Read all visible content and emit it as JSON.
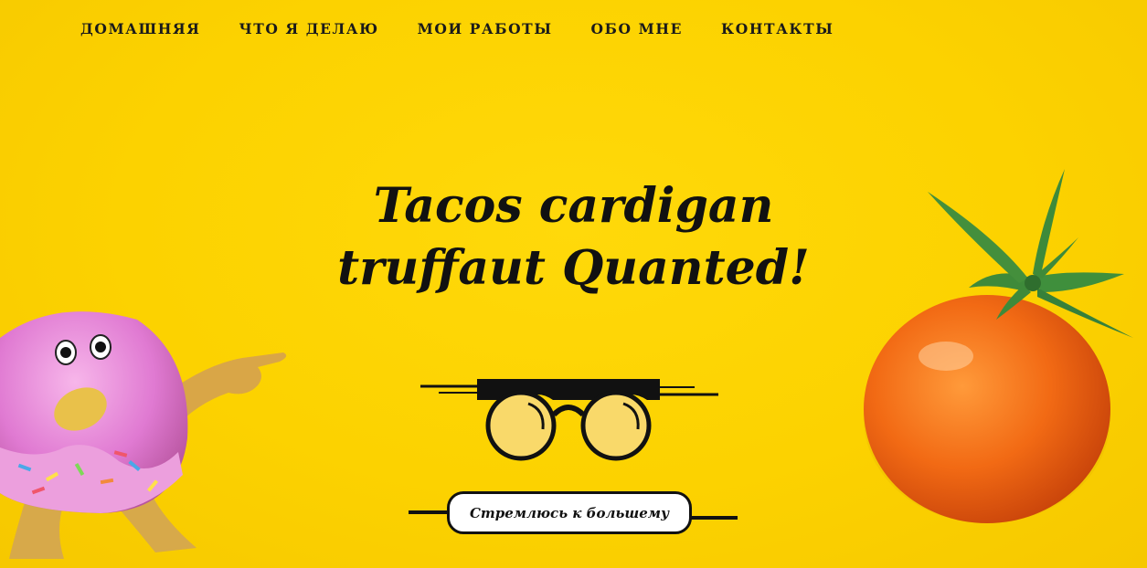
{
  "nav": {
    "items": [
      {
        "label": "ДОМАШНЯЯ"
      },
      {
        "label": "ЧТО Я ДЕЛАЮ"
      },
      {
        "label": "МОИ РАБОТЫ"
      },
      {
        "label": "ОБО МНЕ"
      },
      {
        "label": "КОНТАКТЫ"
      }
    ]
  },
  "hero": {
    "headline_line1": "Tacos cardigan",
    "headline_line2": "truffaut Quanted!",
    "cta_label": "Стремлюсь к большему"
  },
  "icons": {
    "logo": "glasses-icon",
    "left_illustration": "donut-character-icon",
    "right_illustration": "tomato-icon"
  },
  "colors": {
    "background": "#fcd200",
    "text": "#111111",
    "button_bg": "#ffffff",
    "lens": "#f9d96a"
  }
}
